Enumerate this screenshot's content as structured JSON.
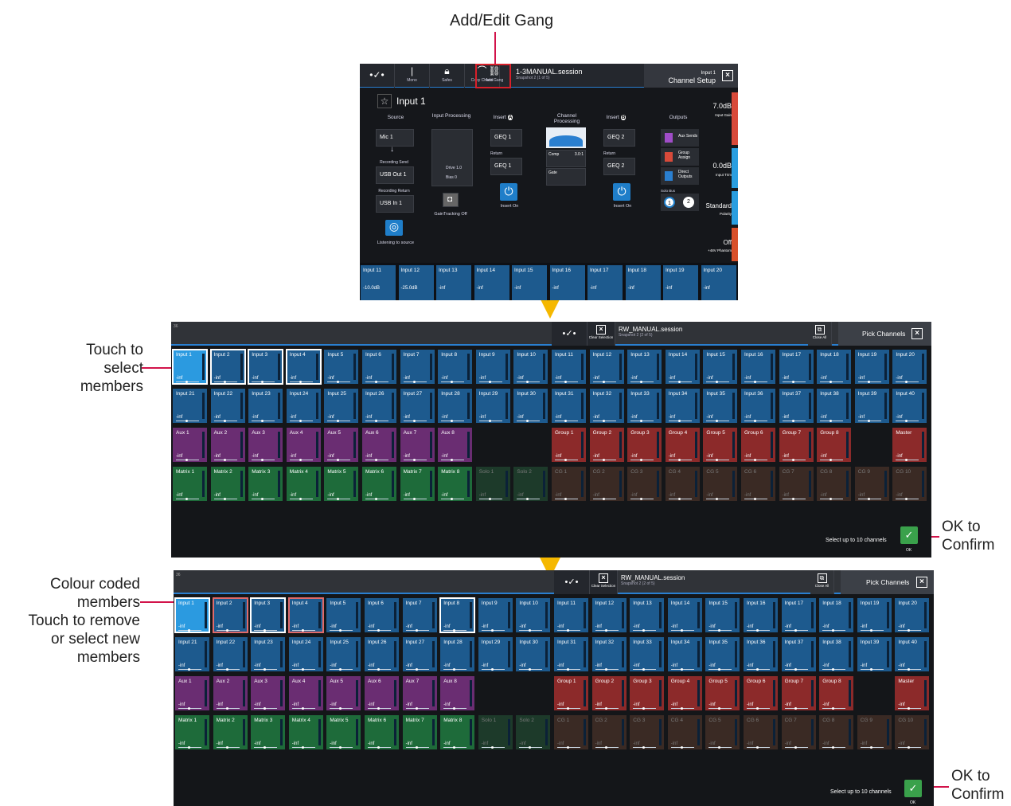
{
  "annotations": {
    "add_edit_gang": "Add/Edit Gang",
    "touch_select": [
      "Touch to",
      "select",
      "members"
    ],
    "ok_confirm_1": [
      "OK to",
      "Confirm"
    ],
    "colour_coded": [
      "Colour coded",
      "members",
      "Touch to remove",
      "or select new",
      "members"
    ],
    "ok_confirm_2": [
      "OK to",
      "Confirm"
    ]
  },
  "colors": {
    "input": "#1d5a8e",
    "input_selected": "#2b9ae0",
    "aux": "#6a2d72",
    "group": "#8c2a2a",
    "matrix": "#1e6b3a",
    "solo": "#1d3a2a",
    "cg": "#3a2a24",
    "accent_line": "#d2134a",
    "arrow": "#f5b800"
  },
  "screen1": {
    "toolbar": {
      "mono": "Mono",
      "safes": "Safes",
      "copy": "Copy Chann",
      "add_gang": "Add Gang",
      "session": "1-3MANUAL.session",
      "snapshot": "Snapshot 2 (1 of 5)",
      "channel_label": "Input 1",
      "channel_setup": "Channel Setup"
    },
    "title": "Input 1",
    "source": "Source",
    "input_processing": "Input Processing",
    "insert_a": "Insert",
    "channel_processing": "Channel Processing",
    "insert_b": "Insert",
    "outputs": "Outputs",
    "mic": "Mic 1",
    "rec_send": "Recording Send",
    "usb_out": "USB Out 1",
    "rec_return": "Recording Return",
    "usb_in": "USB In 1",
    "listening": "Listening to source",
    "gaintracking": "GainTracking Off",
    "geq1": "GEQ 1",
    "return": "Return",
    "geq1b": "GEQ 1",
    "insert_on": "Insert On",
    "geq2": "GEQ 2",
    "return2": "Return",
    "geq2b": "GEQ 2",
    "insert_on2": "Insert On",
    "comp": "Comp",
    "ratio": "3.0:1",
    "gate": "Gate",
    "drive": "Drive",
    "drive_val": "1.0",
    "bias": "Bias",
    "bias_val": "0",
    "aux_sends": "Aux Sends",
    "group_assign": "Group Assign",
    "direct_outputs": "Direct Outputs",
    "solo_bus": "Solo Bus",
    "input_gain_val": "7.0dB",
    "input_gain": "Input Gain",
    "input_trim_val": "0.0dB",
    "input_trim": "Input Trim",
    "polarity_val": "Standard",
    "polarity": "Polarity",
    "phantom_val": "Off",
    "phantom": "+48V Phantom",
    "strip": [
      {
        "name": "Input 11",
        "val": "-10.0dB"
      },
      {
        "name": "Input 12",
        "val": "-25.0dB"
      },
      {
        "name": "Input 13",
        "val": "-inf"
      },
      {
        "name": "Input 14",
        "val": "-inf"
      },
      {
        "name": "Input 15",
        "val": "-inf"
      },
      {
        "name": "Input 16",
        "val": "-inf"
      },
      {
        "name": "Input 17",
        "val": "-inf"
      },
      {
        "name": "Input 18",
        "val": "-inf"
      },
      {
        "name": "Input 19",
        "val": "-inf"
      },
      {
        "name": "Input 20",
        "val": "-inf"
      }
    ]
  },
  "picker": {
    "number": "36",
    "clear_selection": "Clear Selection",
    "session": "RW_MANUAL.session",
    "snapshot": "Snapshot 2 (2 of 5)",
    "close_all": "Close All",
    "title": "Pick Channels",
    "select_hint": "Select up to 10 channels",
    "ok": "OK",
    "row1": [
      "Input 1",
      "Input 2",
      "Input 3",
      "Input 4",
      "Input 5",
      "Input 6",
      "Input 7",
      "Input 8",
      "Input 9",
      "Input 10",
      "Input 11",
      "Input 12",
      "Input 13",
      "Input 14",
      "Input 15",
      "Input 16",
      "Input 17",
      "Input 18",
      "Input 19",
      "Input 20"
    ],
    "row2": [
      "Input 21",
      "Input 22",
      "Input 23",
      "Input 24",
      "Input 25",
      "Input 26",
      "Input 27",
      "Input 28",
      "Input 29",
      "Input 30",
      "Input 31",
      "Input 32",
      "Input 33",
      "Input 34",
      "Input 35",
      "Input 36",
      "Input 37",
      "Input 38",
      "Input 39",
      "Input 40"
    ],
    "row3": [
      "Aux 1",
      "Aux 2",
      "Aux 3",
      "Aux 4",
      "Aux 5",
      "Aux 6",
      "Aux 7",
      "Aux 8",
      "",
      "",
      "Group 1",
      "Group 2",
      "Group 3",
      "Group 4",
      "Group 5",
      "Group 6",
      "Group 7",
      "Group 8",
      "",
      "Master"
    ],
    "row4": [
      "Matrix 1",
      "Matrix 2",
      "Matrix 3",
      "Matrix 4",
      "Matrix 5",
      "Matrix 6",
      "Matrix 7",
      "Matrix 8",
      "Solo 1",
      "Solo 2",
      "CG 1",
      "CG 2",
      "CG 3",
      "CG 4",
      "CG 5",
      "CG 6",
      "CG 7",
      "CG 8",
      "CG 9",
      "CG 10"
    ],
    "value": "-inf"
  }
}
